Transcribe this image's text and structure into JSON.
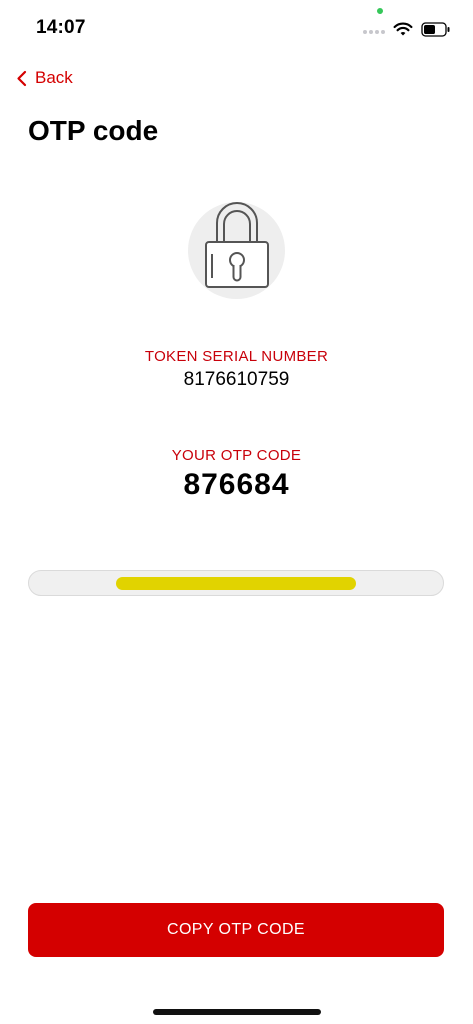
{
  "status_bar": {
    "time": "14:07",
    "icons": [
      "signal-dots-icon",
      "wifi-icon",
      "battery-icon"
    ]
  },
  "header": {
    "back_label": "Back",
    "title": "OTP code"
  },
  "illustration": {
    "icon": "padlock-icon"
  },
  "token": {
    "label": "TOKEN SERIAL NUMBER",
    "value": "8176610759"
  },
  "otp": {
    "label": "YOUR OTP CODE",
    "value": "876684"
  },
  "progress": {
    "remaining_start": 0.21,
    "remaining_end": 0.79
  },
  "actions": {
    "copy_label": "COPY OTP CODE"
  },
  "colors": {
    "accent": "#d40000",
    "label": "#c8000a",
    "progress_fill": "#e1d300",
    "progress_track": "#f0f0f0"
  }
}
